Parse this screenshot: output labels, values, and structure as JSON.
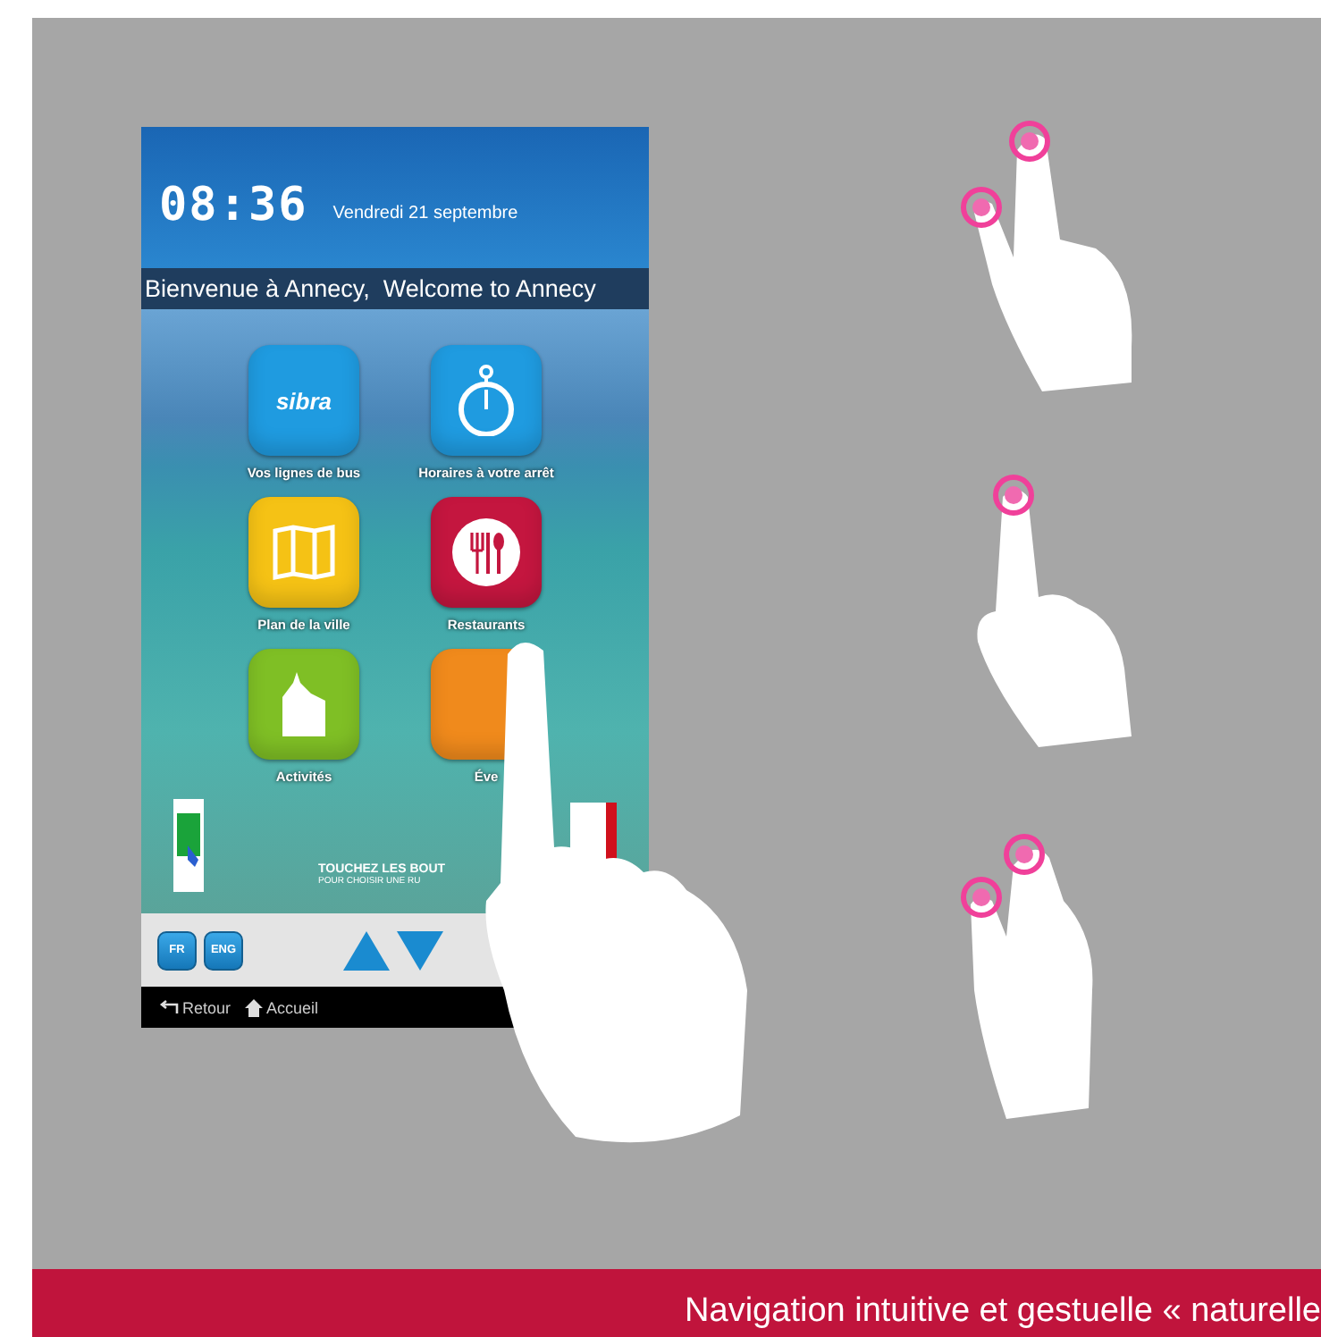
{
  "kiosk": {
    "time": "08:36",
    "date": "Vendredi 21 septembre",
    "welcome": "Bienvenue à Annecy,  Welcome to Annecy",
    "tiles": [
      {
        "label": "Vos lignes de bus",
        "color": "#1f9be0",
        "logo_text": "sibra"
      },
      {
        "label": "Horaires à votre arrêt",
        "color": "#1f9be0"
      },
      {
        "label": "Plan de la ville",
        "color": "#f5c215"
      },
      {
        "label": "Restaurants",
        "color": "#c4163f"
      },
      {
        "label": "Activités",
        "color": "#7fbf25"
      },
      {
        "label": "Éve",
        "color": "#f08a1c"
      }
    ],
    "hint": [
      "TOUCHEZ LES BOUT",
      "POUR CHOISIR UNE RU"
    ],
    "languages": [
      {
        "label": "FR"
      },
      {
        "label": "ENG"
      }
    ],
    "nav": [
      {
        "label": "Retour"
      },
      {
        "label": "Accueil"
      }
    ]
  },
  "banner": "Navigation intuitive et gestuelle « naturelle"
}
